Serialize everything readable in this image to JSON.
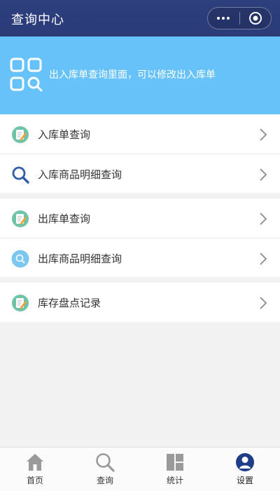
{
  "header": {
    "title": "查询中心"
  },
  "banner": {
    "text": "出入库单查询里面，可以修改出入库单"
  },
  "menu": {
    "groups": [
      {
        "items": [
          {
            "label": "入库单查询",
            "icon": "edit-note-icon"
          },
          {
            "label": "入库商品明细查询",
            "icon": "magnifier-icon"
          }
        ]
      },
      {
        "items": [
          {
            "label": "出库单查询",
            "icon": "edit-note-icon"
          },
          {
            "label": "出库商品明细查询",
            "icon": "search-circle-icon"
          }
        ]
      },
      {
        "items": [
          {
            "label": "库存盘点记录",
            "icon": "edit-note-icon"
          }
        ]
      }
    ]
  },
  "tabbar": {
    "tabs": [
      {
        "label": "首页",
        "icon": "home-icon"
      },
      {
        "label": "查询",
        "icon": "search-icon"
      },
      {
        "label": "统计",
        "icon": "dashboard-icon"
      },
      {
        "label": "设置",
        "icon": "user-icon",
        "active": true
      }
    ]
  },
  "colors": {
    "header_bg": "#2e3f7e",
    "banner_bg": "#67c2f9",
    "active_tab": "#1f3c88"
  }
}
